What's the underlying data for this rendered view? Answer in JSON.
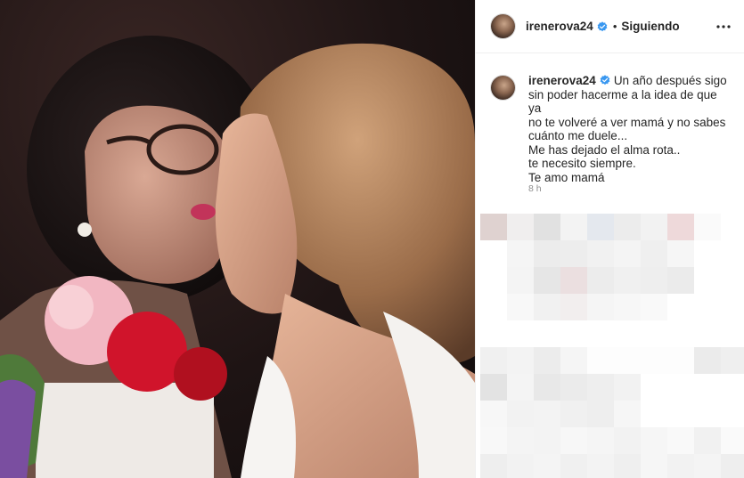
{
  "post": {
    "username": "irenerova24",
    "following_label": "Siguiendo",
    "dot": "•",
    "caption": {
      "lines": [
        "Un año después sigo",
        "sin poder hacerme a la idea de que ya",
        "no te volveré a ver mamá y no sabes",
        "cuánto me duele...",
        "Me has dejado el alma rota..",
        "te necesito siempre.",
        "Te amo mamá"
      ]
    },
    "time": "8 h",
    "verified_color": "#3897f0",
    "icons": {
      "verified": "verified-badge-icon",
      "more": "more-options-icon"
    }
  }
}
